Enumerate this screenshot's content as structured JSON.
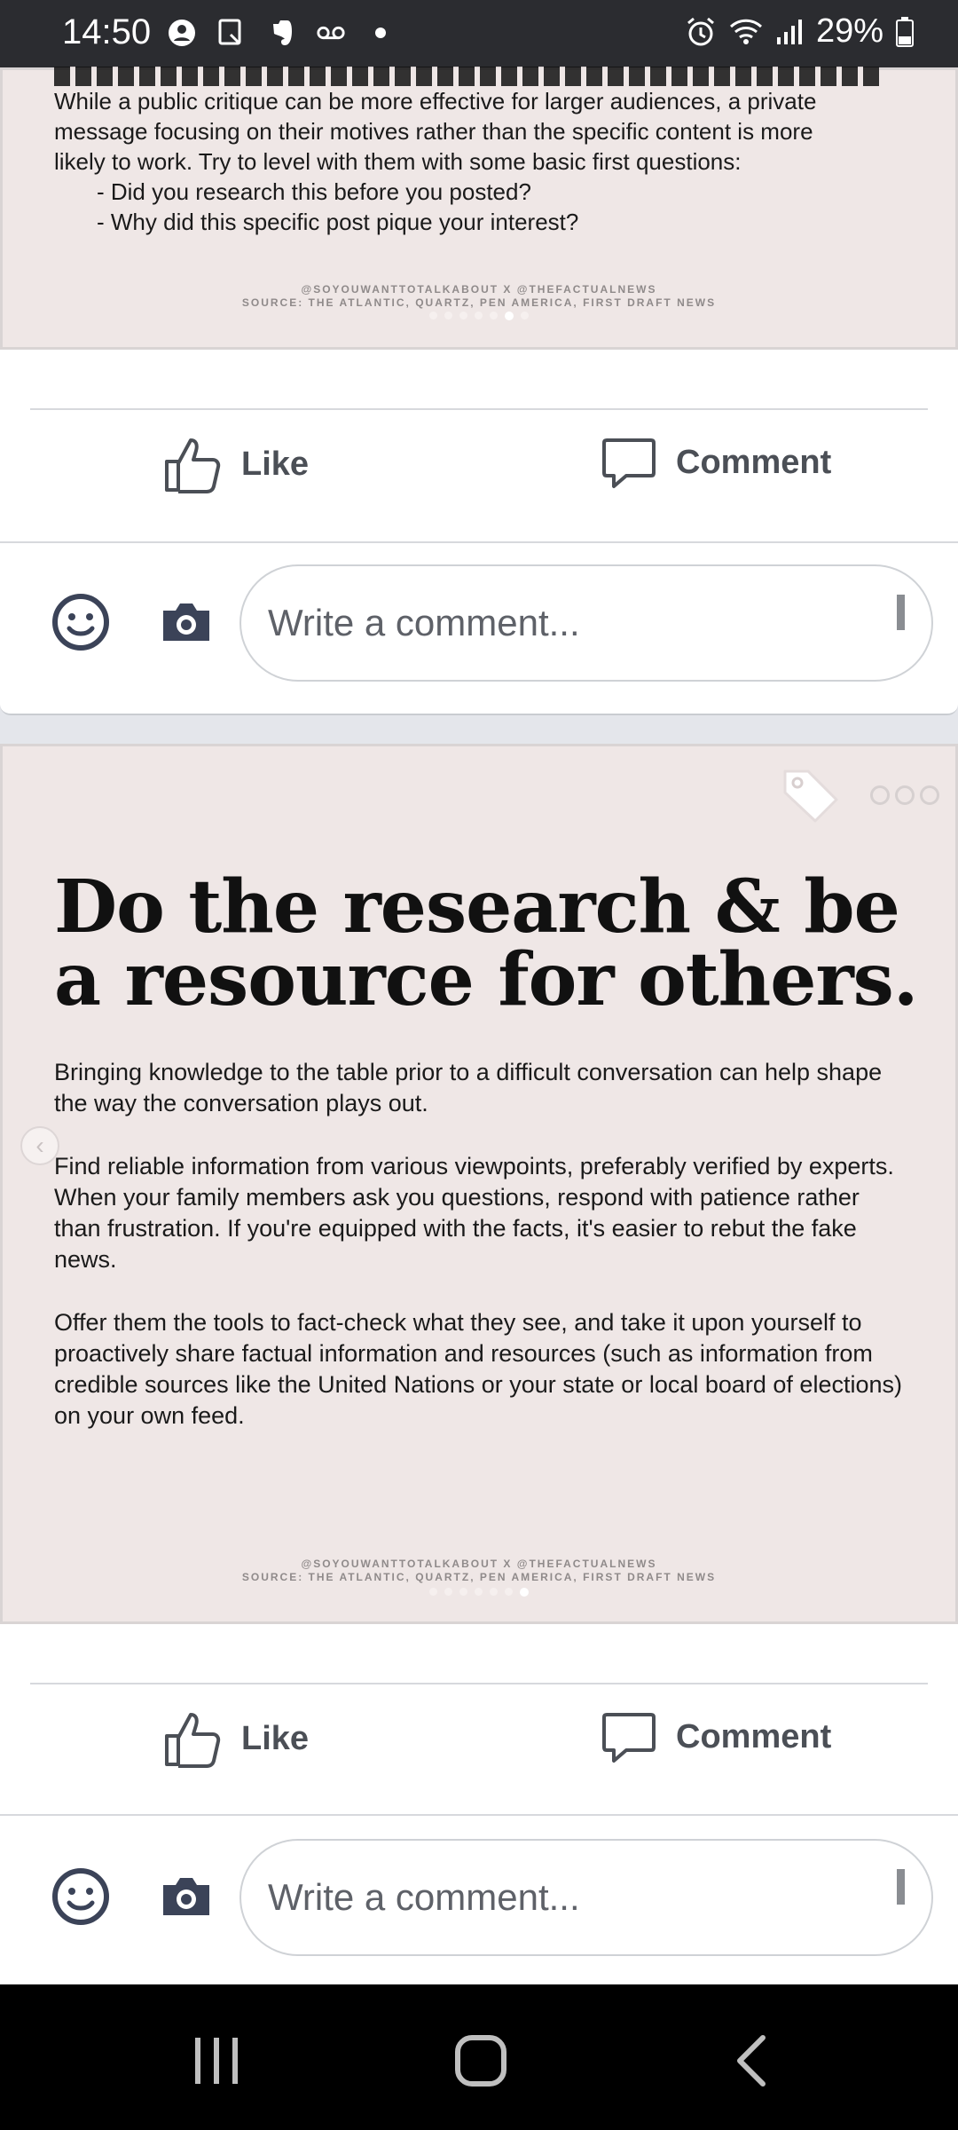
{
  "status_bar": {
    "time": "14:50",
    "battery": "29%"
  },
  "posts": [
    {
      "image": {
        "body_line1": "While a public critique can be more effective for larger audiences, a private",
        "body_line2": "message focusing on their motives rather than the specific content is more",
        "body_line3": "likely to work. Try to level with them with some basic first questions:",
        "q1": "- Did you research this before you posted?",
        "q2": "- Why did this specific post pique your interest?",
        "source_line1": "@SOYOUWANTTOTALKABOUT X @THEFACTUALNEWS",
        "source_line2": "SOURCE: THE ATLANTIC, QUARTZ, PEN AMERICA, FIRST DRAFT NEWS"
      },
      "actions": {
        "like": "Like",
        "comment": "Comment"
      },
      "comment_placeholder": "Write a comment..."
    },
    {
      "image": {
        "title_line1": "Do the research & be",
        "title_line2": "a resource for others.",
        "para1": "Bringing knowledge to the table prior to a difficult conversation can help shape the way the conversation plays out.",
        "para2": "Find reliable information from various viewpoints, preferably verified by experts. When your family members ask you questions, respond with patience rather than frustration. If you're equipped with the facts, it's easier to rebut the fake news.",
        "para3": "Offer them the tools to fact-check what they see, and take it upon yourself to proactively share factual information and resources (such as information from credible sources like the United Nations or your state or local board of elections) on your own feed.",
        "source_line1": "@SOYOUWANTTOTALKABOUT X @THEFACTUALNEWS",
        "source_line2": "SOURCE: THE ATLANTIC, QUARTZ, PEN AMERICA, FIRST DRAFT NEWS"
      },
      "actions": {
        "like": "Like",
        "comment": "Comment"
      },
      "comment_placeholder": "Write a comment..."
    }
  ],
  "colors": {
    "accent": "#4b4f56",
    "post_bg": "#efe7e6",
    "status_bar_bg": "#2b2c30"
  }
}
